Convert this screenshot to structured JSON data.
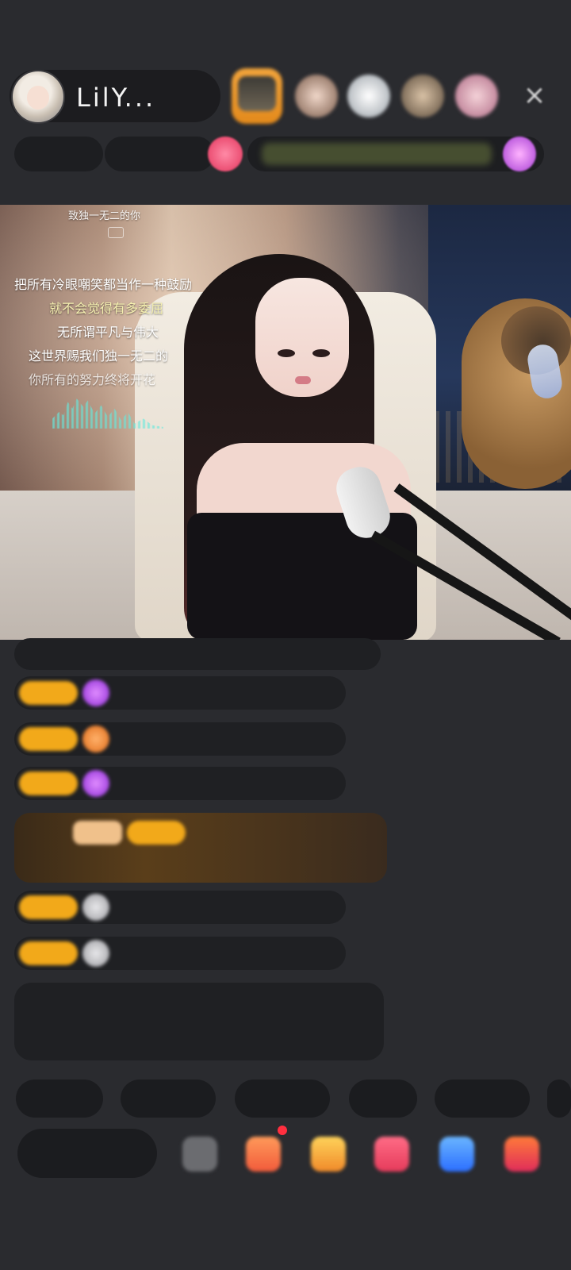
{
  "header": {
    "streamer_name": "LilY..."
  },
  "video": {
    "lyrics": [
      "致独一无二的你",
      "把所有冷眼嘲笑都当作一种鼓励",
      "就不会觉得有多委屈",
      "无所谓平凡与伟大",
      "这世界赐我们独一无二的",
      "你所有的努力终将开花"
    ]
  },
  "colors": {
    "background": "#2a2b2f",
    "accent_gold": "#f2a91a",
    "chat_green": "#b9e487"
  }
}
